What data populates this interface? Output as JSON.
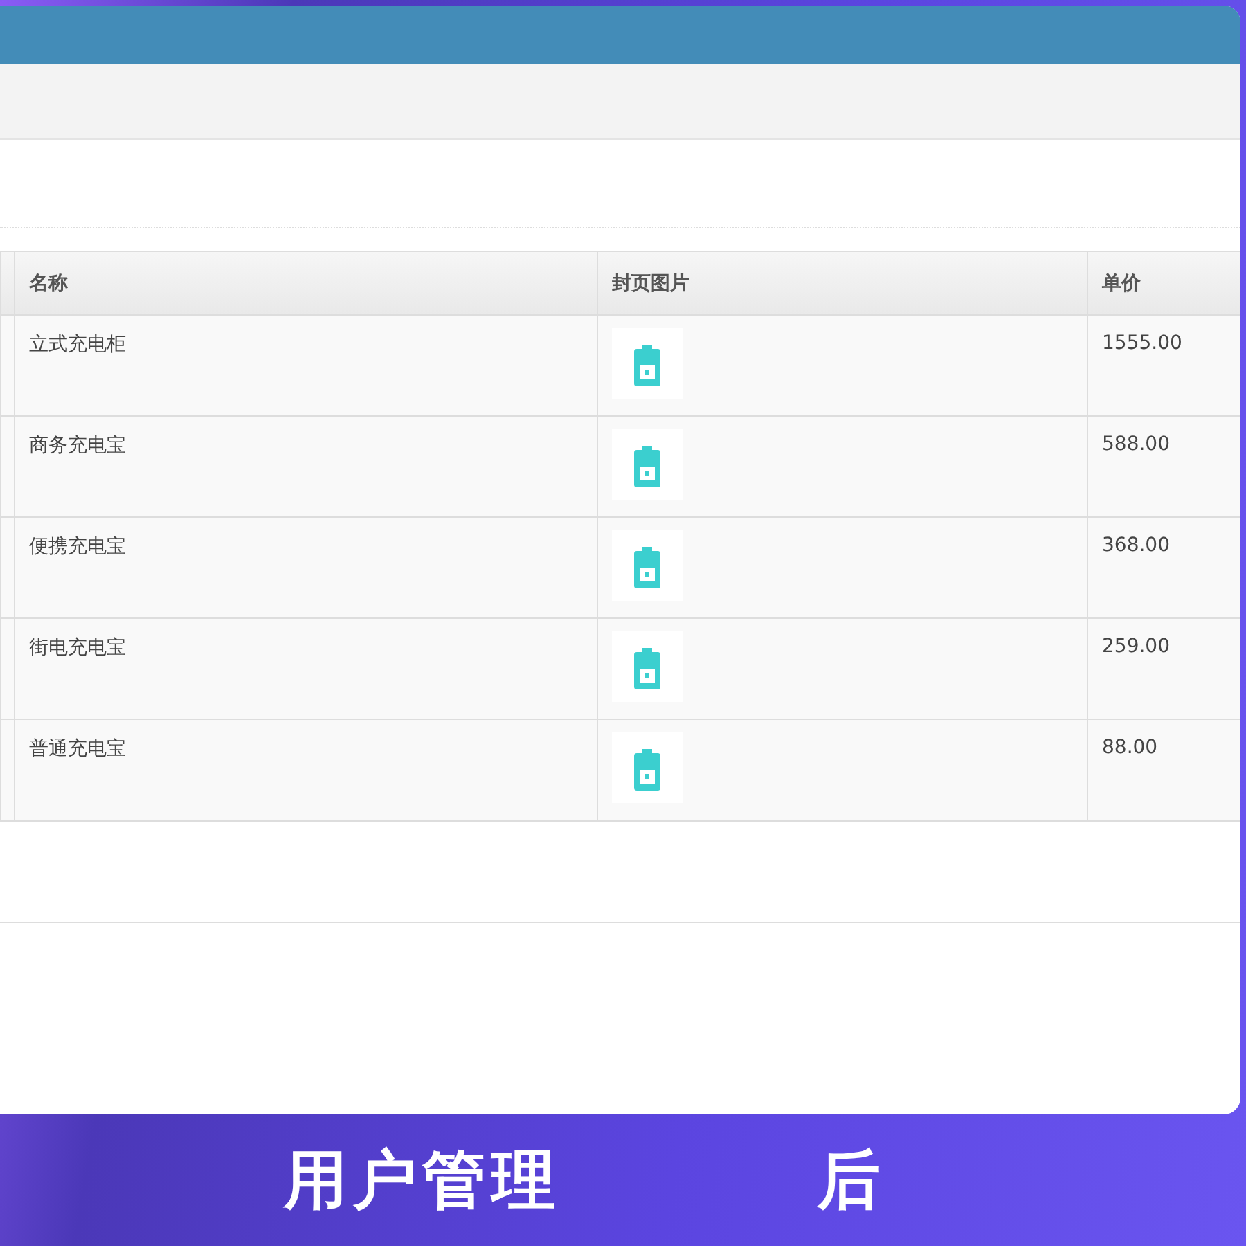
{
  "table": {
    "columns": [
      "名称",
      "封页图片",
      "单价"
    ],
    "rows": [
      {
        "name": "立式充电柜",
        "price": "1555.00"
      },
      {
        "name": "商务充电宝",
        "price": "588.00"
      },
      {
        "name": "便携充电宝",
        "price": "368.00"
      },
      {
        "name": "街电充电宝",
        "price": "259.00"
      },
      {
        "name": "普通充电宝",
        "price": "88.00"
      }
    ]
  },
  "banner": {
    "captions": [
      "用户管理",
      "后"
    ]
  }
}
